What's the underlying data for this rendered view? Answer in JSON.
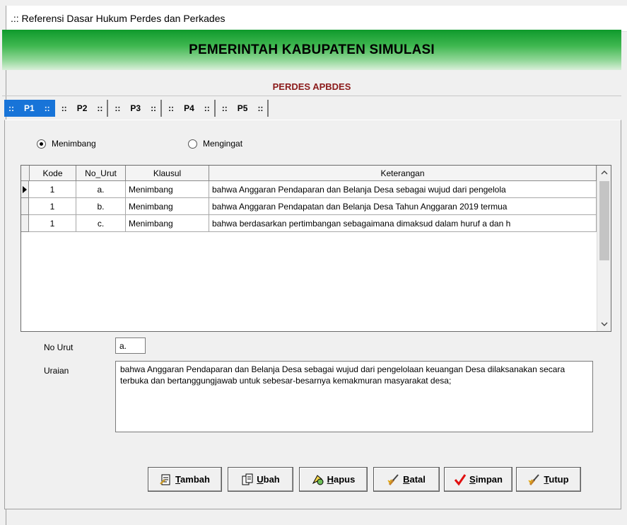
{
  "window": {
    "title": ".:: Referensi Dasar Hukum Perdes dan Perkades"
  },
  "banner": {
    "title": "PEMERINTAH KABUPATEN SIMULASI"
  },
  "subheader": {
    "title": "PERDES APBDES"
  },
  "tabs": [
    {
      "label": "P1",
      "active": true
    },
    {
      "label": "P2",
      "active": false
    },
    {
      "label": "P3",
      "active": false
    },
    {
      "label": "P4",
      "active": false
    },
    {
      "label": "P5",
      "active": false
    }
  ],
  "tab_marker": "::",
  "radios": [
    {
      "label": "Menimbang",
      "checked": true
    },
    {
      "label": "Mengingat",
      "checked": false
    }
  ],
  "grid": {
    "columns": [
      "Kode",
      "No_Urut",
      "Klausul",
      "Keterangan"
    ],
    "rows": [
      [
        "1",
        "a.",
        "Menimbang",
        "bahwa Anggaran Pendaparan dan Belanja Desa sebagai wujud dari pengelola"
      ],
      [
        "1",
        "b.",
        "Menimbang",
        "bahwa Anggaran Pendapatan dan Belanja Desa Tahun Anggaran 2019 termua"
      ],
      [
        "1",
        "c.",
        "Menimbang",
        "bahwa berdasarkan pertimbangan sebagaimana dimaksud dalam huruf a dan h"
      ]
    ],
    "selected_row": 0
  },
  "form": {
    "no_urut_label": "No Urut",
    "no_urut_value": "a.",
    "uraian_label": "Uraian",
    "uraian_value": "bahwa Anggaran Pendaparan dan Belanja Desa sebagai wujud dari pengelolaan keuangan Desa dilaksanakan secara terbuka dan bertanggungjawab untuk sebesar-besarnya kemakmuran masyarakat desa;"
  },
  "buttons": {
    "tambah": {
      "first": "T",
      "rest": "ambah",
      "icon": "add-doc-icon"
    },
    "ubah": {
      "first": "U",
      "rest": "bah",
      "icon": "edit-doc-icon"
    },
    "hapus": {
      "first": "H",
      "rest": "apus",
      "icon": "delete-doc-icon"
    },
    "batal": {
      "first": "B",
      "rest": "atal",
      "icon": "cancel-brush-icon"
    },
    "simpan": {
      "first": "S",
      "rest": "impan",
      "icon": "checkmark-icon"
    },
    "tutup": {
      "first": "T",
      "rest": "utup",
      "icon": "close-brush-icon"
    }
  },
  "colors": {
    "banner_green": "#0f9a2c",
    "subheader_red": "#8b1a1a",
    "tab_active": "#1874d8",
    "check_red": "#e01010"
  }
}
